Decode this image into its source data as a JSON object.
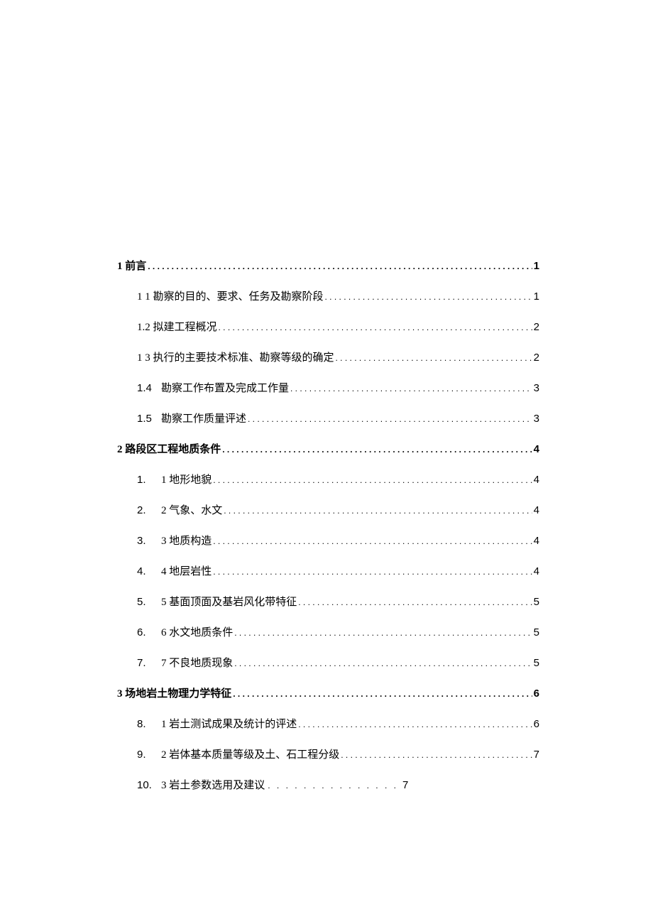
{
  "toc": {
    "s1": {
      "label": "1 前言",
      "page": "1"
    },
    "s1_1": {
      "label": "1 1 勘察的目的、要求、任务及勘察阶段",
      "page": "1"
    },
    "s1_2": {
      "label": "1.2 拟建工程概况",
      "page": "2"
    },
    "s1_3": {
      "label": "1 3 执行的主要技术标准、勘察等级的确定",
      "page": "2"
    },
    "s1_4": {
      "num": "1.4",
      "label": "勘察工作布置及完成工作量",
      "page": "3"
    },
    "s1_5": {
      "num": "1.5",
      "label": "勘察工作质量评述",
      "page": "3"
    },
    "s2": {
      "label": "2 路段区工程地质条件",
      "page": "4"
    },
    "s2_1": {
      "num": "1.",
      "label": "1 地形地貌",
      "page": "4"
    },
    "s2_2": {
      "num": "2.",
      "label": "2 气象、水文",
      "page": "4"
    },
    "s2_3": {
      "num": "3.",
      "label": "3 地质构造",
      "page": "4"
    },
    "s2_4": {
      "num": "4.",
      "label": "4 地层岩性",
      "page": "4"
    },
    "s2_5": {
      "num": "5.",
      "label": "5 基面顶面及基岩风化带特征",
      "page": "5"
    },
    "s2_6": {
      "num": "6.",
      "label": "6 水文地质条件",
      "page": "5"
    },
    "s2_7": {
      "num": "7.",
      "label": "7 不良地质现象",
      "page": "5"
    },
    "s3": {
      "label": "3 场地岩土物理力学特征",
      "page": "6"
    },
    "s3_1": {
      "num": "8.",
      "label": "1 岩土测试成果及统计的评述",
      "page": "6"
    },
    "s3_2": {
      "num": "9.",
      "label": "2 岩体基本质量等级及土、石工程分级",
      "page": "7"
    },
    "s3_3": {
      "num": "10.",
      "label": "3 岩土参数选用及建议",
      "dots": ". . . . . . . . . . . . . . .",
      "page": "7"
    }
  }
}
